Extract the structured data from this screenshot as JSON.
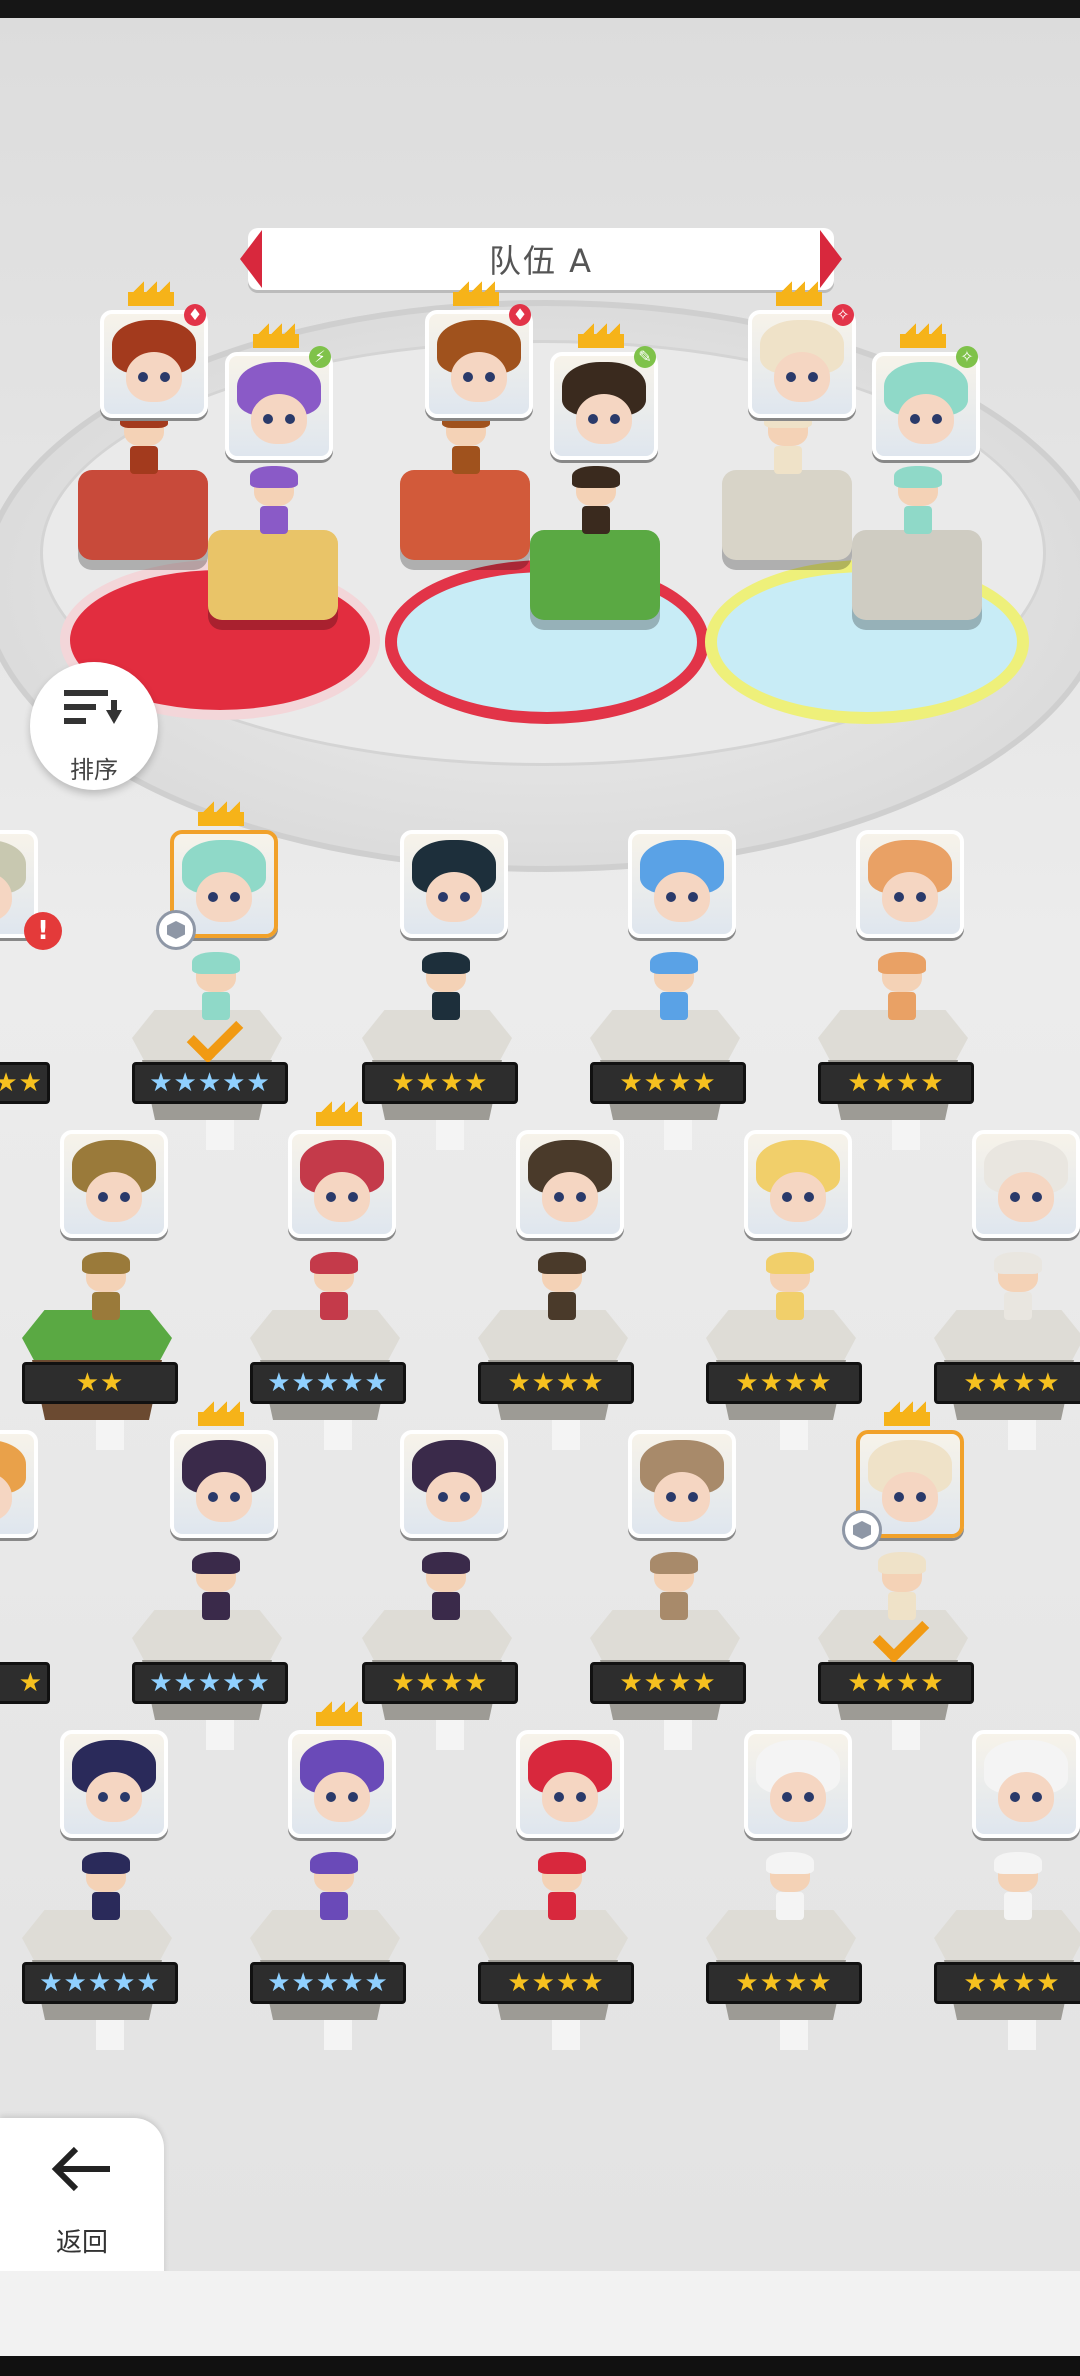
{
  "team": {
    "title": "队伍 A"
  },
  "buttons": {
    "sort_label": "排序",
    "back_label": "返回"
  },
  "colors": {
    "red_slot": "#e22d3f",
    "blue_slot": "#c8ecf6",
    "crown": "#f6b319",
    "select_border": "#f1a12a"
  },
  "team_slots": [
    {
      "name": "slot-1-front",
      "portrait_hair": "#a33a1d",
      "badge": "♦"
    },
    {
      "name": "slot-1-back",
      "portrait_hair": "#8a5ac7",
      "badge": "⚡"
    },
    {
      "name": "slot-2-front",
      "portrait_hair": "#a0521d",
      "badge": "♦"
    },
    {
      "name": "slot-2-back",
      "portrait_hair": "#3a2a1e",
      "badge": "✎"
    },
    {
      "name": "slot-3-front",
      "portrait_hair": "#efe2c8",
      "badge": "✧"
    },
    {
      "name": "slot-3-back",
      "portrait_hair": "#8fd9c8",
      "badge": "✧"
    }
  ],
  "roster": [
    {
      "stars": "★★★★★",
      "rainbow": true,
      "hair": "#8fd9c8",
      "selected": true,
      "crown": true
    },
    {
      "stars": "★★★★",
      "rainbow": false,
      "hair": "#1d2f3b"
    },
    {
      "stars": "★★★★",
      "rainbow": false,
      "hair": "#5aa2e6"
    },
    {
      "stars": "★★★★",
      "rainbow": false,
      "hair": "#e9a165"
    },
    {
      "stars": "★★",
      "rainbow": false,
      "hair": "#9a7a3a",
      "grass": true
    },
    {
      "stars": "★★★★★",
      "rainbow": true,
      "hair": "#c43a4a",
      "crown": true
    },
    {
      "stars": "★★★★",
      "rainbow": false,
      "hair": "#4a3a2a"
    },
    {
      "stars": "★★★★",
      "rainbow": false,
      "hair": "#f1cf6a"
    },
    {
      "stars": "★★★★",
      "rainbow": false,
      "hair": "#e9e6e0"
    },
    {
      "stars": "★★★★★",
      "rainbow": true,
      "hair": "#3a2a4a",
      "crown": true
    },
    {
      "stars": "★★★★",
      "rainbow": false,
      "hair": "#3a2a4a"
    },
    {
      "stars": "★★★★",
      "rainbow": false,
      "hair": "#a88a6a"
    },
    {
      "stars": "★★★★",
      "rainbow": false,
      "hair": "#efe2c8",
      "selected": true,
      "crown": true
    },
    {
      "stars": "★★★★★",
      "rainbow": true,
      "hair": "#2a2a5a"
    },
    {
      "stars": "★★★★★",
      "rainbow": true,
      "hair": "#6a4ab8",
      "crown": true
    },
    {
      "stars": "★★★★",
      "rainbow": false,
      "hair": "#d8283d"
    },
    {
      "stars": "★★★★",
      "rainbow": false,
      "hair": "#f4f4f4"
    },
    {
      "stars": "★★★★",
      "rainbow": false,
      "hair": "#f4f4f4"
    }
  ],
  "partial_left": [
    {
      "stars": "★★",
      "hair": "#c8c8b0"
    },
    {
      "stars": "★",
      "hair": "#e9a14a"
    }
  ]
}
